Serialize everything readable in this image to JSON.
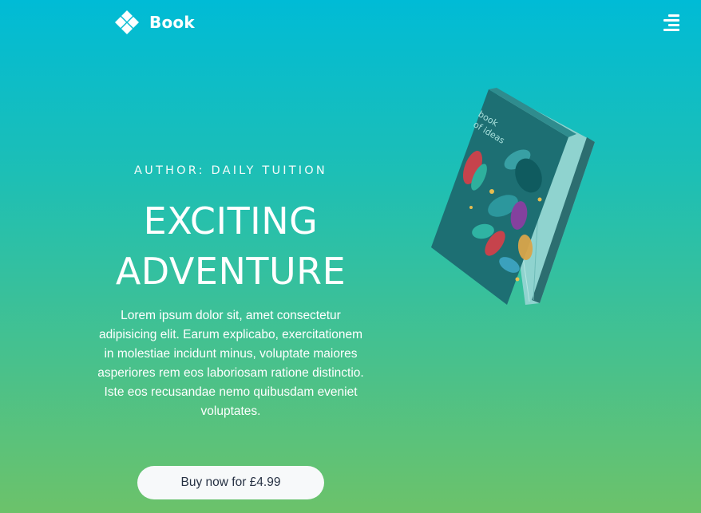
{
  "header": {
    "brand_name": "Book",
    "logo_icon": "four-diamond-logo-icon",
    "menu_icon": "hamburger-menu-icon"
  },
  "hero": {
    "author_line": "AUTHOR: DAILY TUITION",
    "title_line1": "EXCITING",
    "title_line2": "ADVENTURE",
    "description": "Lorem ipsum dolor sit, amet consectetur adipisicing elit. Earum explicabo, exercitationem in molestiae incidunt minus, voluptate maiores asperiores rem eos laboriosam ratione distinctio. Iste eos recusandae nemo quibusdam eveniet voluptates.",
    "buy_button_label": "Buy now for £4.99"
  },
  "book_image": {
    "cover_title_line1": "book",
    "cover_title_line2": "of ideas",
    "icon": "book-cover-image"
  },
  "colors": {
    "gradient_top": "#00bbd6",
    "gradient_bottom": "#6cc26a",
    "button_bg": "#f7f9fa",
    "button_text": "#273244",
    "book_cover": "#1d6f73"
  }
}
